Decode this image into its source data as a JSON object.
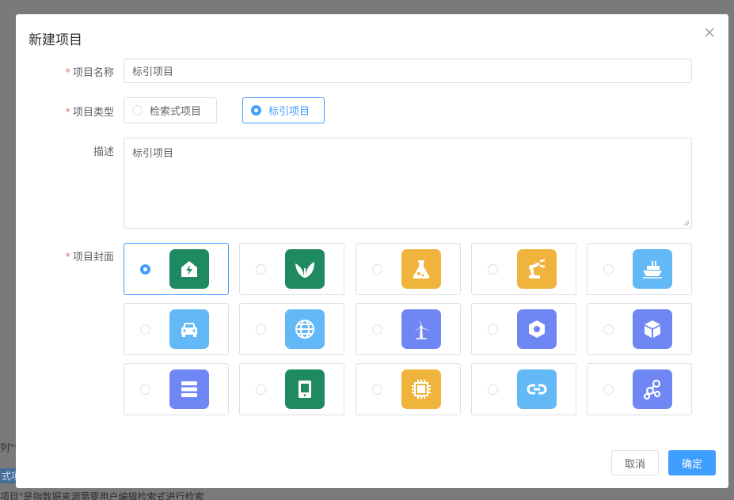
{
  "background": {
    "fragment_a": "列\"专",
    "fragment_b": "式项",
    "fragment_c": "项目\"是指数据来源需要用户编辑检索式进行检索"
  },
  "dialog": {
    "title": "新建项目",
    "close_icon": "close-icon"
  },
  "form": {
    "name_label": "项目名称",
    "name_value": "标引项目",
    "type_label": "项目类型",
    "type_options": [
      "检索式项目",
      "标引项目"
    ],
    "type_selected": "标引项目",
    "desc_label": "描述",
    "desc_value": "标引项目",
    "cover_label": "项目封面",
    "required_mark": "*"
  },
  "covers": [
    {
      "icon": "house-bolt-icon",
      "color": "#1f8a62",
      "selected": true
    },
    {
      "icon": "leaf-icon",
      "color": "#1f8a62",
      "selected": false
    },
    {
      "icon": "flask-icon",
      "color": "#f0b43c",
      "selected": false
    },
    {
      "icon": "robot-arm-icon",
      "color": "#f0b43c",
      "selected": false
    },
    {
      "icon": "ship-icon",
      "color": "#63b8f6",
      "selected": false
    },
    {
      "icon": "car-icon",
      "color": "#63b8f6",
      "selected": false
    },
    {
      "icon": "globe-icon",
      "color": "#63b8f6",
      "selected": false
    },
    {
      "icon": "wind-turbine-icon",
      "color": "#6f86f5",
      "selected": false
    },
    {
      "icon": "hex-nut-icon",
      "color": "#6f86f5",
      "selected": false
    },
    {
      "icon": "cube-icon",
      "color": "#6f86f5",
      "selected": false
    },
    {
      "icon": "server-icon",
      "color": "#6f86f5",
      "selected": false
    },
    {
      "icon": "tablet-icon",
      "color": "#1f8a62",
      "selected": false
    },
    {
      "icon": "chip-icon",
      "color": "#f0b43c",
      "selected": false
    },
    {
      "icon": "link-icon",
      "color": "#63b8f6",
      "selected": false
    },
    {
      "icon": "molecule-icon",
      "color": "#6f86f5",
      "selected": false
    }
  ],
  "footer": {
    "cancel_label": "取消",
    "ok_label": "确定"
  },
  "colors": {
    "primary": "#409eff",
    "required": "#f56c6c",
    "border": "#dcdfe6"
  }
}
